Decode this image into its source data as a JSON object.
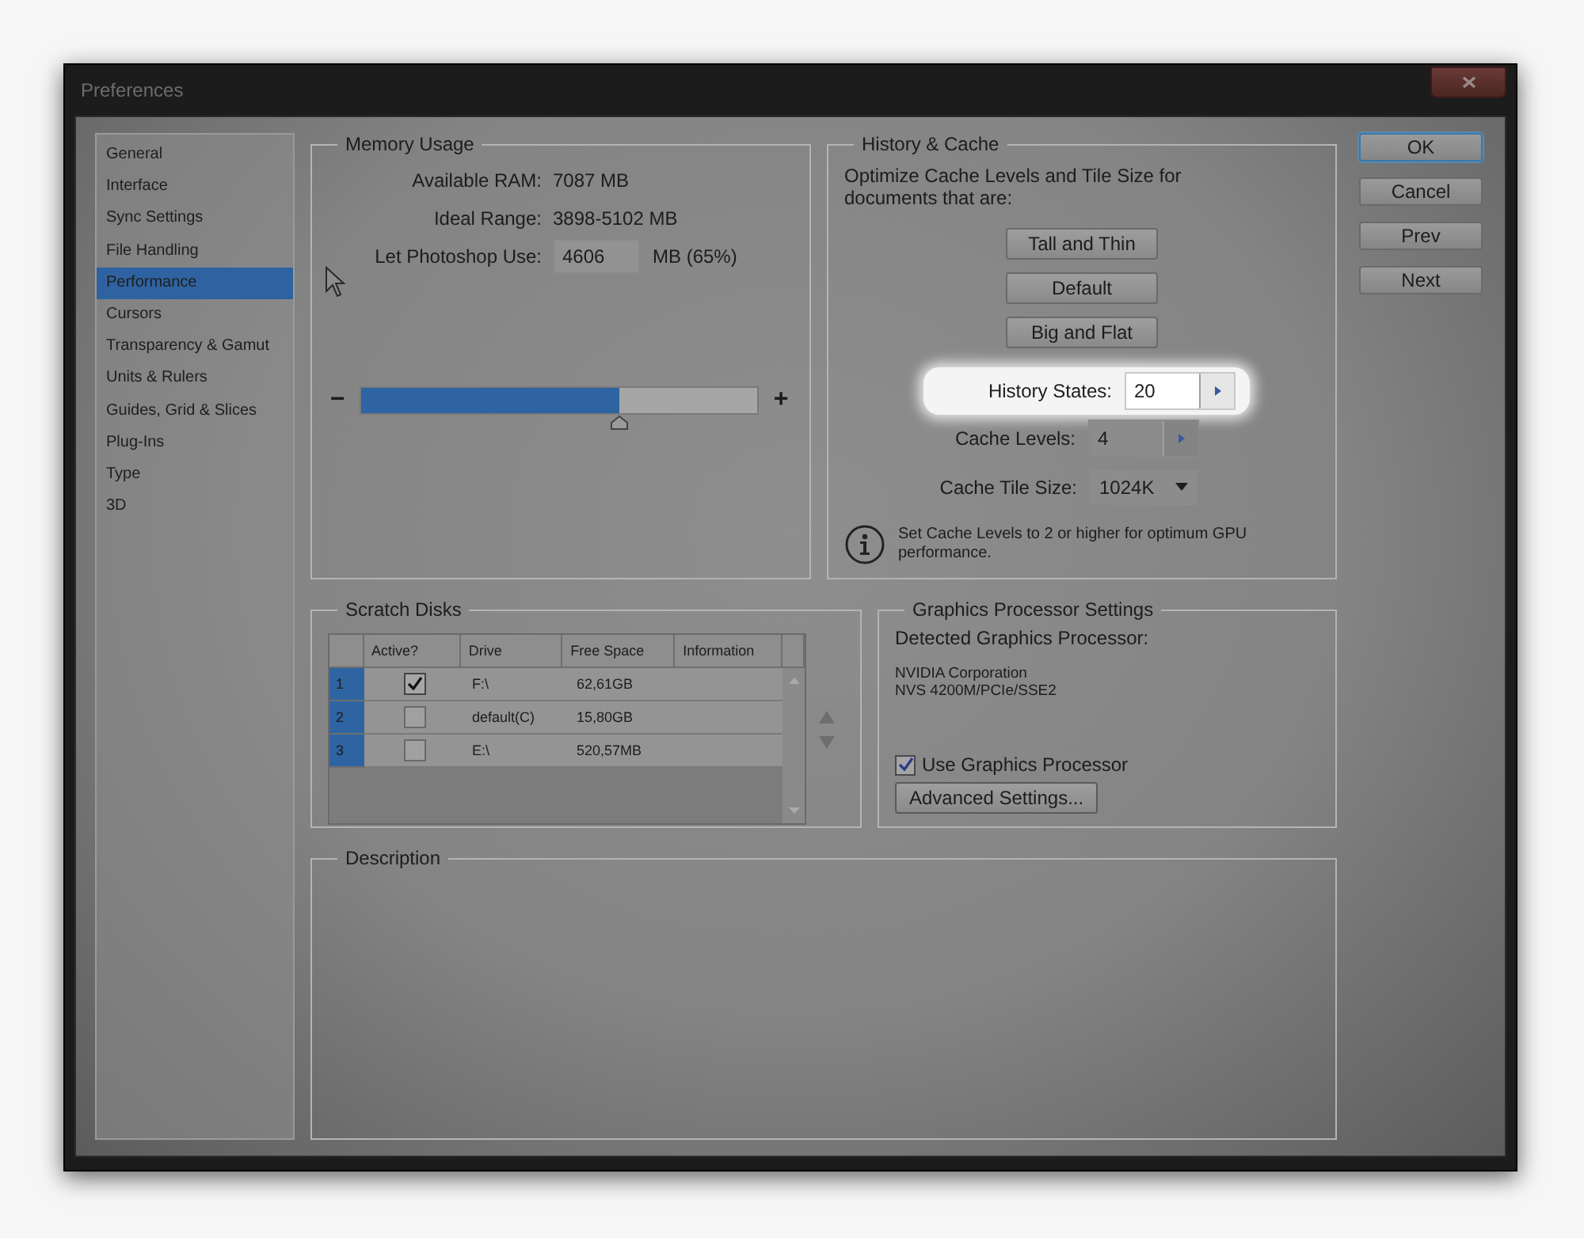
{
  "window": {
    "title": "Preferences"
  },
  "sidebar": {
    "items": [
      {
        "label": "General",
        "selected": false
      },
      {
        "label": "Interface",
        "selected": false
      },
      {
        "label": "Sync Settings",
        "selected": false
      },
      {
        "label": "File Handling",
        "selected": false
      },
      {
        "label": "Performance",
        "selected": true
      },
      {
        "label": "Cursors",
        "selected": false
      },
      {
        "label": "Transparency & Gamut",
        "selected": false
      },
      {
        "label": "Units & Rulers",
        "selected": false
      },
      {
        "label": "Guides, Grid & Slices",
        "selected": false
      },
      {
        "label": "Plug-Ins",
        "selected": false
      },
      {
        "label": "Type",
        "selected": false
      },
      {
        "label": "3D",
        "selected": false
      }
    ]
  },
  "memory_usage": {
    "title": "Memory Usage",
    "rows": [
      {
        "label": "Available RAM:",
        "value": "7087 MB"
      },
      {
        "label": "Ideal Range:",
        "value": "3898-5102 MB"
      }
    ],
    "use": {
      "label": "Let Photoshop Use:",
      "value": "4606",
      "unit": "MB (65%)"
    },
    "slider": {
      "minus": "−",
      "plus": "+",
      "level": 0.65
    }
  },
  "history_cache": {
    "title": "History & Cache",
    "description": "Optimize Cache Levels and Tile Size for documents that are:",
    "presets": [
      "Tall and Thin",
      "Default",
      "Big and Flat"
    ],
    "fields": [
      {
        "kind": "stepper",
        "label": "History States:",
        "value": "20",
        "highlighted": true
      },
      {
        "kind": "stepper",
        "label": "Cache Levels:",
        "value": "4",
        "highlighted": false
      },
      {
        "kind": "dropdown",
        "label": "Cache Tile Size:",
        "value": "1024K",
        "highlighted": false
      }
    ],
    "note": "Set Cache Levels to 2 or higher for optimum GPU performance."
  },
  "buttons": [
    {
      "label": "OK",
      "default": true
    },
    {
      "label": "Cancel",
      "default": false
    },
    {
      "label": "Prev",
      "default": false
    },
    {
      "label": "Next",
      "default": false
    }
  ],
  "scratch_disks": {
    "title": "Scratch Disks",
    "columns": [
      "Active?",
      "Drive",
      "Free Space",
      "Information"
    ],
    "rows": [
      {
        "number": "1",
        "active": true,
        "drive": "F:\\",
        "free_space": "62,61GB"
      },
      {
        "number": "2",
        "active": false,
        "drive": "default(C)",
        "free_space": "15,80GB"
      },
      {
        "number": "3",
        "active": false,
        "drive": "E:\\",
        "free_space": "520,57MB"
      }
    ]
  },
  "graphics_processor": {
    "title": "Graphics Processor Settings",
    "detected_label": "Detected Graphics Processor:",
    "processor_lines": [
      "NVIDIA Corporation",
      "NVS 4200M/PCIe/SSE2"
    ],
    "use_gpu": {
      "label": "Use Graphics Processor",
      "checked": true
    },
    "advanced_button": "Advanced Settings..."
  },
  "description": {
    "title": "Description"
  }
}
